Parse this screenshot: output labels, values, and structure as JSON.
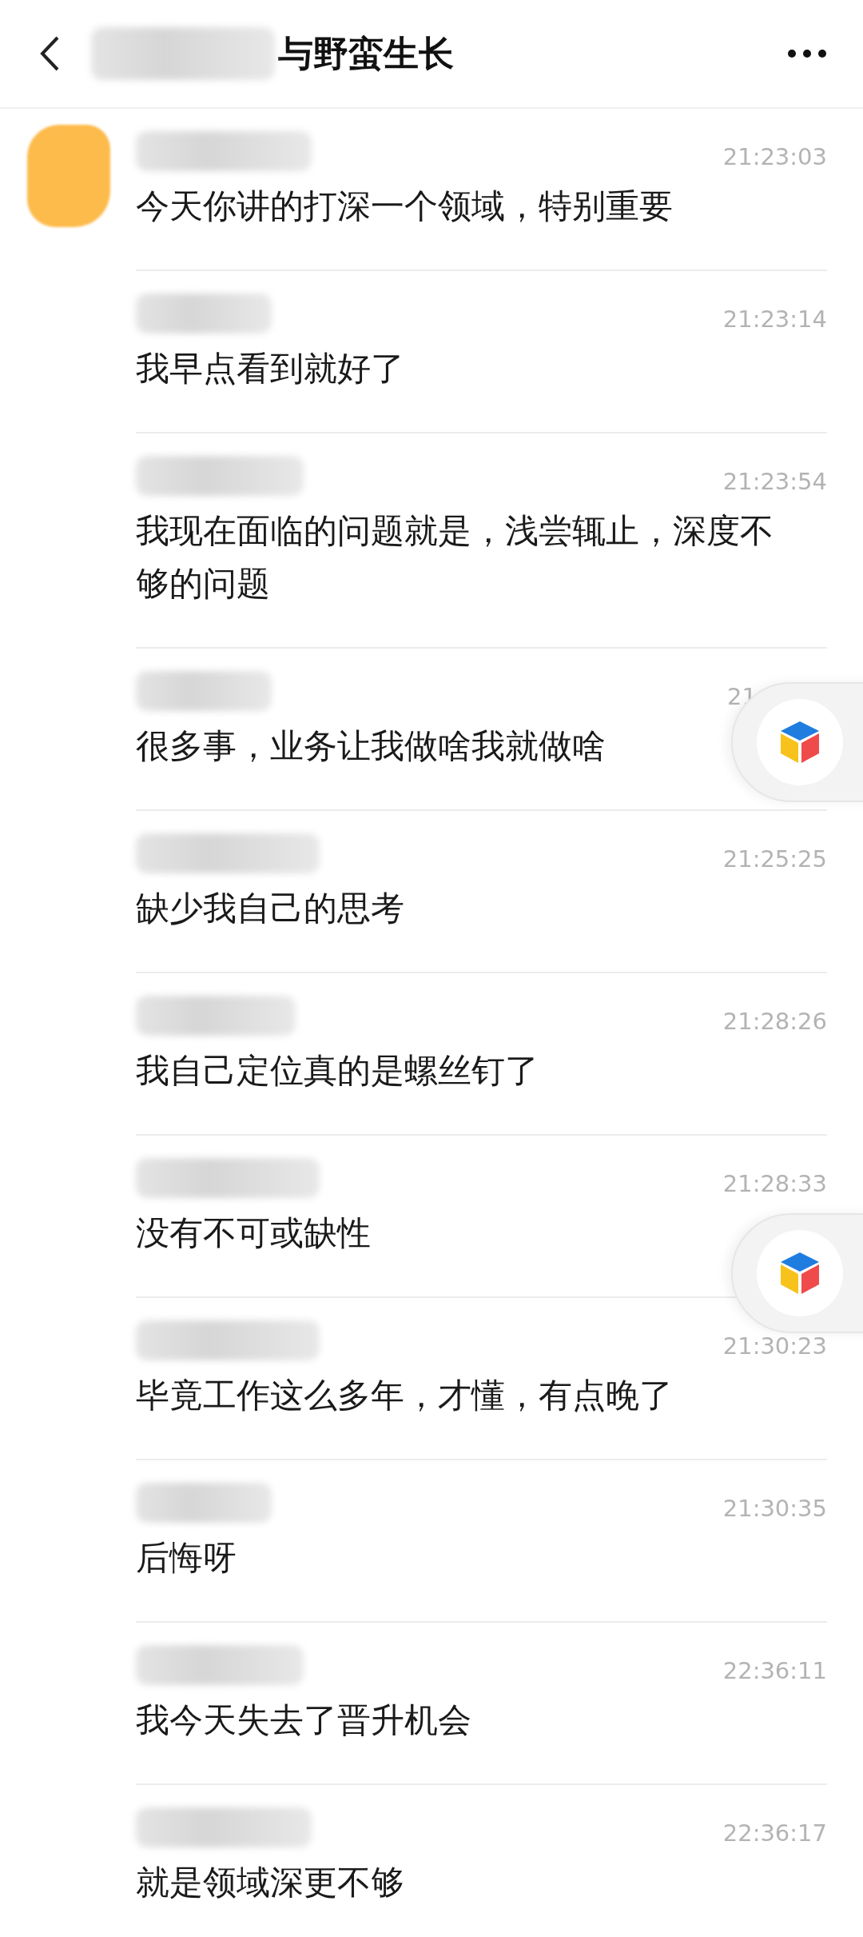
{
  "header": {
    "title": "与野蛮生长"
  },
  "messages": [
    {
      "show_avatar": true,
      "time": "21:23:03",
      "text": "今天你讲的打深一个领域，特别重要"
    },
    {
      "show_avatar": false,
      "time": "21:23:14",
      "text": "我早点看到就好了"
    },
    {
      "show_avatar": false,
      "time": "21:23:54",
      "text": "我现在面临的问题就是，浅尝辄止，深度不够的问题"
    },
    {
      "show_avatar": false,
      "time": "21",
      "time_covered": true,
      "text": "很多事，业务让我做啥我就做啥"
    },
    {
      "show_avatar": false,
      "time": "21:25:25",
      "text": "缺少我自己的思考"
    },
    {
      "show_avatar": false,
      "time": "21:28:26",
      "text": "我自己定位真的是螺丝钉了"
    },
    {
      "show_avatar": false,
      "time": "21:28:33",
      "text": "没有不可或缺性"
    },
    {
      "show_avatar": false,
      "time": "21:30:23",
      "text": "毕竟工作这么多年，才懂，有点晚了"
    },
    {
      "show_avatar": false,
      "time": "21:30:35",
      "text": "后悔呀"
    },
    {
      "show_avatar": false,
      "time": "22:36:11",
      "text": "我今天失去了晋升机会"
    },
    {
      "show_avatar": false,
      "time": "22:36:17",
      "text": "就是领域深更不够"
    }
  ]
}
